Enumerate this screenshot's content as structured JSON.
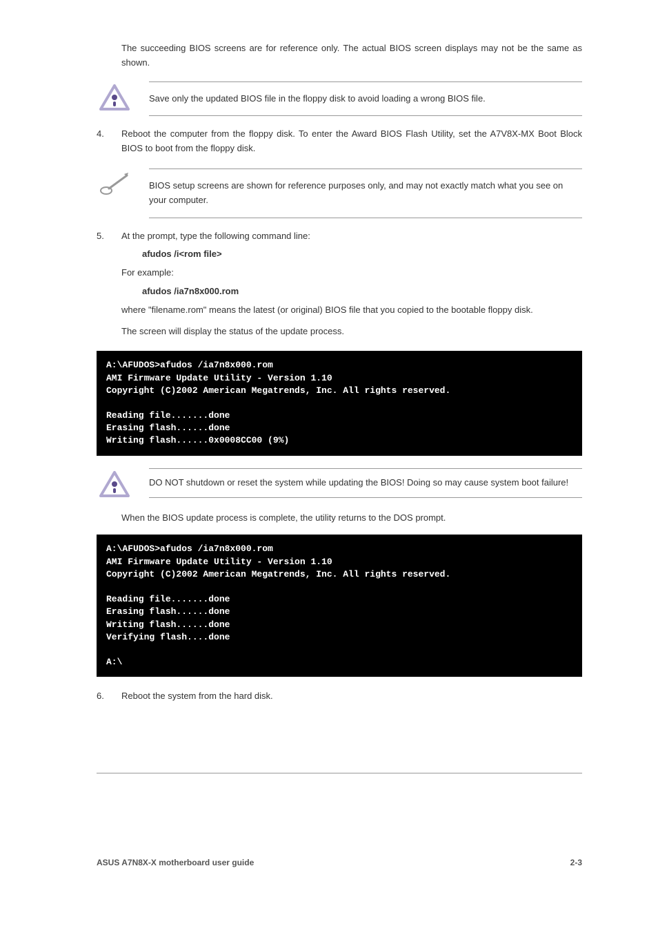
{
  "intro": "The succeeding BIOS screens are for reference only. The actual BIOS screen displays may not be the same as shown.",
  "caution1": "Save only the updated BIOS file in the floppy disk to avoid loading a wrong BIOS file.",
  "step4": {
    "num": "4.",
    "text": "Reboot the computer from the floppy disk. To enter the Award BIOS Flash Utility, set the A7V8X-MX Boot Block BIOS to boot from the floppy disk."
  },
  "note1": "BIOS setup screens are shown for reference purposes only, and may not exactly match what you see on your computer.",
  "step5": {
    "num": "5.",
    "text_a": "At the prompt, type the following command line:",
    "cmd": "afudos /i<rom file>",
    "text_b": "For example:",
    "cmd_b": "afudos /ia7n8x000.rom",
    "text_c": "where \"filename.rom\" means the latest (or original) BIOS file that you copied to the bootable floppy disk.",
    "text_d": "The screen will display the status of the update process."
  },
  "terminal1": "A:\\AFUDOS>afudos /ia7n8x000.rom\nAMI Firmware Update Utility - Version 1.10\nCopyright (C)2002 American Megatrends, Inc. All rights reserved.\n\nReading file.......done\nErasing flash......done\nWriting flash......0x0008CC00 (9%)",
  "caution2": "DO NOT shutdown or reset the system while updating the BIOS! Doing so may cause system boot failure!",
  "terminal2_intro": "When the BIOS update process is complete, the utility returns to the DOS prompt.",
  "terminal2": "A:\\AFUDOS>afudos /ia7n8x000.rom\nAMI Firmware Update Utility - Version 1.10\nCopyright (C)2002 American Megatrends, Inc. All rights reserved.\n\nReading file.......done\nErasing flash......done\nWriting flash......done\nVerifying flash....done\n\nA:\\",
  "step6": {
    "num": "6.",
    "text": "Reboot the system from the hard disk."
  },
  "footer": {
    "left": "ASUS A7N8X-X motherboard user guide",
    "right": "2-3"
  },
  "icons": {
    "caution": "caution-icon",
    "note": "note-icon"
  }
}
